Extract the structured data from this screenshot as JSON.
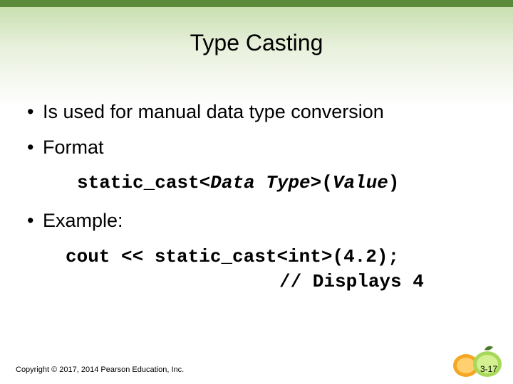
{
  "slide": {
    "title": "Type Casting",
    "bullets": {
      "b1": "Is used for manual data type conversion",
      "b2": "Format",
      "b3": "Example:"
    },
    "format_code": {
      "p1": "static_cast<",
      "p2": "Data Type",
      "p3": ">(",
      "p4": "Value",
      "p5": ")"
    },
    "example_code": {
      "line1": "cout << static_cast<int>(4.2);",
      "line2": "// Displays 4"
    },
    "footer": {
      "copyright": "Copyright © 2017, 2014 Pearson Education, Inc.",
      "page": "3-17"
    }
  }
}
